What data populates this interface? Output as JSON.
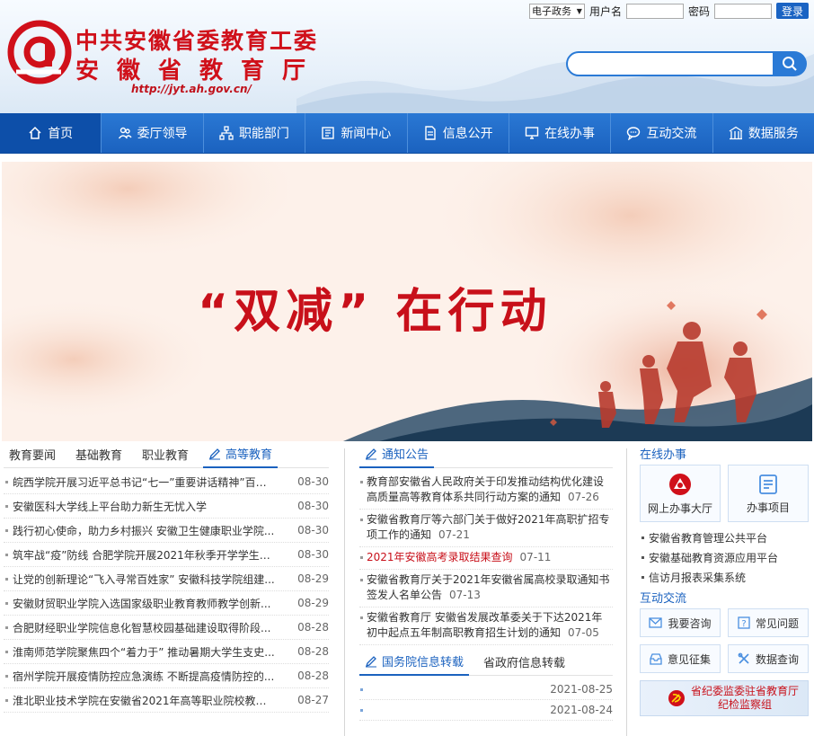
{
  "header": {
    "title_line1": "中共安徽省委教育工委",
    "title_line2": "安徽省教育厅",
    "url": "http://jyt.ah.gov.cn/",
    "login": {
      "system_select": "电子政务",
      "username_label": "用户名",
      "password_label": "密码",
      "login_button": "登录"
    }
  },
  "nav": {
    "items": [
      {
        "label": "首页",
        "icon": "home-icon"
      },
      {
        "label": "委厅领导",
        "icon": "people-icon"
      },
      {
        "label": "职能部门",
        "icon": "org-chart-icon"
      },
      {
        "label": "新闻中心",
        "icon": "news-icon"
      },
      {
        "label": "信息公开",
        "icon": "document-icon"
      },
      {
        "label": "在线办事",
        "icon": "monitor-icon"
      },
      {
        "label": "互动交流",
        "icon": "chat-icon"
      },
      {
        "label": "数据服务",
        "icon": "building-icon"
      }
    ]
  },
  "banner": {
    "title": "“双减” 在行动"
  },
  "left": {
    "tabs": [
      "教育要闻",
      "基础教育",
      "职业教育",
      "高等教育"
    ],
    "news": [
      {
        "title": "皖西学院开展习近平总书记“七一”重要讲话精神”百人...",
        "date": "08-30"
      },
      {
        "title": "安徽医科大学线上平台助力新生无忧入学",
        "date": "08-30"
      },
      {
        "title": "践行初心使命，助力乡村振兴 安徽卫生健康职业学院...",
        "date": "08-30"
      },
      {
        "title": "筑牢战“疫”防线 合肥学院开展2021年秋季开学学生返...",
        "date": "08-30"
      },
      {
        "title": "让党的创新理论“飞入寻常百姓家” 安徽科技学院组建...",
        "date": "08-29"
      },
      {
        "title": "安徽财贸职业学院入选国家级职业教育教师教学创新...",
        "date": "08-29"
      },
      {
        "title": "合肥财经职业学院信息化智慧校园基础建设取得阶段...",
        "date": "08-28"
      },
      {
        "title": "淮南师范学院聚焦四个“着力于” 推动暑期大学生支史...",
        "date": "08-28"
      },
      {
        "title": "宿州学院开展疫情防控应急演练 不断提高疫情防控的...",
        "date": "08-28"
      },
      {
        "title": "淮北职业技术学院在安徽省2021年高等职业院校教学...",
        "date": "08-27"
      }
    ]
  },
  "mid": {
    "notice_tab": "通知公告",
    "notices": [
      {
        "title": "教育部安徽省人民政府关于印发推动结构优化建设高质量高等教育体系共同行动方案的通知",
        "date": "07-26",
        "highlight": false
      },
      {
        "title": "安徽省教育厅等六部门关于做好2021年高职扩招专项工作的通知",
        "date": "07-21",
        "highlight": false
      },
      {
        "title": "2021年安徽高考录取结果查询",
        "date": "07-11",
        "highlight": true
      },
      {
        "title": "安徽省教育厅关于2021年安徽省属高校录取通知书签发人名单公告",
        "date": "07-13",
        "highlight": false
      },
      {
        "title": "安徽省教育厅 安徽省发展改革委关于下达2021年初中起点五年制高职教育招生计划的通知",
        "date": "07-05",
        "highlight": false
      }
    ],
    "gov_tabs": [
      "国务院信息转载",
      "省政府信息转载"
    ],
    "gov_items": [
      {
        "date": "2021-08-25"
      },
      {
        "date": "2021-08-24"
      }
    ]
  },
  "right": {
    "online_label": "在线办事",
    "services": [
      {
        "label": "网上办事大厅",
        "icon": "hall-logo-icon"
      },
      {
        "label": "办事项目",
        "icon": "list-icon"
      }
    ],
    "links": [
      "安徽省教育管理公共平台",
      "安徽基础教育资源应用平台",
      "信访月报表采集系统"
    ],
    "interact_label": "互动交流",
    "interact_buttons": [
      {
        "label": "我要咨询",
        "icon": "mail-icon"
      },
      {
        "label": "常见问题",
        "icon": "question-icon"
      },
      {
        "label": "意见征集",
        "icon": "inbox-icon"
      },
      {
        "label": "数据查询",
        "icon": "tools-icon"
      }
    ],
    "party_banner_line1": "省纪委监委驻省教育厅",
    "party_banner_line2": "纪检监察组"
  },
  "colors": {
    "brand_blue": "#1b62bf",
    "brand_red": "#c8101a"
  }
}
